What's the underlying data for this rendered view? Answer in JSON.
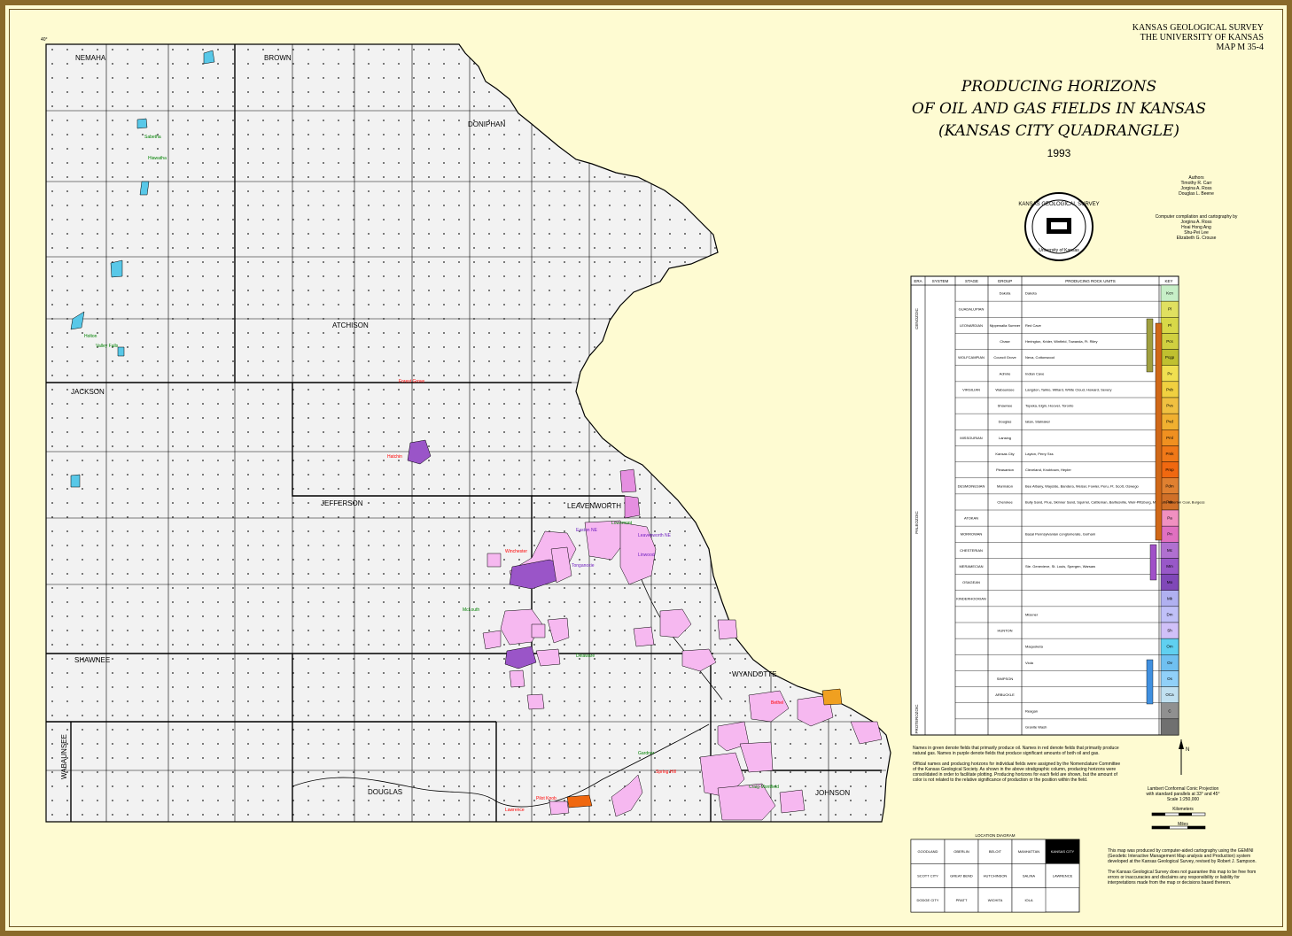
{
  "header": {
    "survey": "KANSAS GEOLOGICAL SURVEY",
    "university": "THE UNIVERSITY OF KANSAS",
    "map_no": "MAP M 35-4"
  },
  "title": {
    "line1": "PRODUCING HORIZONS",
    "line2": "OF OIL AND GAS FIELDS IN KANSAS",
    "line3": "(KANSAS CITY QUADRANGLE)",
    "year": "1993"
  },
  "credits": {
    "authors_label": "Authors",
    "authors": [
      "Timothy R. Carr",
      "Jorgina A. Ross",
      "Douglas L. Beene"
    ],
    "computer_label": "Computer compilation and cartography by",
    "computer": [
      "Jorgina A. Ross",
      "Hoai Hong Ang",
      "Shu-Pei Lee",
      "Elizabeth G. Crouse"
    ]
  },
  "seal": {
    "outer": "KANSAS GEOLOGICAL SURVEY",
    "inner": "University of Kansas"
  },
  "counties": [
    {
      "name": "NEMAHA"
    },
    {
      "name": "BROWN"
    },
    {
      "name": "DONIPHAN"
    },
    {
      "name": "ATCHISON"
    },
    {
      "name": "JACKSON"
    },
    {
      "name": "JEFFERSON"
    },
    {
      "name": "LEAVENWORTH"
    },
    {
      "name": "SHAWNEE"
    },
    {
      "name": "WYANDOTTE"
    },
    {
      "name": "DOUGLAS"
    },
    {
      "name": "JOHNSON"
    },
    {
      "name": "WABAUNSEE"
    }
  ],
  "colors": {
    "paper": "#fefbd2",
    "land": "#f2f2f2",
    "oil": "#f6b8f0",
    "gas": "#9a55c8",
    "oil_gas_oil": "#e58fe0",
    "cyan": "#58c8e8",
    "orange": "#f0a020",
    "frame": "#8a6a2a"
  },
  "strat_table": {
    "headers": [
      "ERA",
      "SYSTEM",
      "STAGE",
      "GROUP",
      "PRODUCING ROCK UNITS",
      "KEY"
    ],
    "rows": [
      {
        "group": "Dakota",
        "units": "Dakota",
        "key": "Kcn",
        "color": "#c7efc7"
      },
      {
        "stage": "GUADALUPIAN",
        "key": "Pl",
        "color": "#e0e060"
      },
      {
        "stage": "LEONARDIAN",
        "group": "Nippewalla Sumner",
        "units": "Red Cave",
        "key": "Pl",
        "color": "#d8d848"
      },
      {
        "group": "Chase",
        "units": "Herington, Krider, Winfield, Towanda, Ft. Riley",
        "key": "Pcs",
        "color": "#d0d040"
      },
      {
        "stage": "WOLFCAMPIAN",
        "group": "Council Grove",
        "units": "Neva, Cottonwood",
        "key": "Pcgp",
        "color": "#c0c030"
      },
      {
        "group": "Admire",
        "units": "Indian Cave",
        "key": "Pv",
        "color": "#f0e050"
      },
      {
        "stage": "VIRGILIAN",
        "group": "Wabaunsee",
        "units": "Langdon, Tarkio, Willard, White Cloud, Howard, Severy",
        "key": "Pvb",
        "color": "#f0d040"
      },
      {
        "group": "Shawnee",
        "units": "Topeka, Elgin, Hoover, Toronto",
        "key": "Pvs",
        "color": "#f0c040"
      },
      {
        "group": "Douglas",
        "units": "Iatan, Stalnaker",
        "key": "Pvd",
        "color": "#f0b030"
      },
      {
        "stage": "MISSOURIAN",
        "group": "Lansing",
        "key": "Pml",
        "color": "#f09020"
      },
      {
        "group": "Kansas City",
        "units": "Layton, Perry Sss",
        "key": "Pmk",
        "color": "#f07818"
      },
      {
        "group": "Pleasanton",
        "units": "Cleveland, Knobtown, Hepler",
        "key": "Pmp",
        "color": "#f06810"
      },
      {
        "stage": "DESMOINESIAN",
        "group": "Marmaton",
        "units": "Bee Albany, Wayside, Bandera, Weiser, Fowler, Peru, Ft. Scott, Oswego",
        "key": "Pdm",
        "color": "#e08030"
      },
      {
        "group": "Cherokee",
        "units": "Bully Sand, Prue, Skinner Sand, Squirrel, Cattleman, Bartlesville, Weir-Pittsburg, McLouth, Riverton Coal, Burgess",
        "key": "Pdc",
        "color": "#d07028"
      },
      {
        "stage": "ATOKAN",
        "key": "Pa",
        "color": "#f090c0"
      },
      {
        "stage": "MORROWAN",
        "units": "Basal Pennsylvanian conglomerate, Gorham",
        "key": "Pn",
        "color": "#e070c0"
      },
      {
        "stage": "CHESTERIAN",
        "key": "Mc",
        "color": "#b070d0"
      },
      {
        "stage": "MERAMECIAN",
        "units": "Ste. Genevieve, St. Louis, Spergen, Warsaw",
        "key": "Mm",
        "color": "#9858c8"
      },
      {
        "stage": "OSAGEAN",
        "key": "Mo",
        "color": "#8048b8"
      },
      {
        "stage": "KINDERHOOKIAN",
        "key": "Mk",
        "color": "#b0b0f0"
      },
      {
        "units": "Misener",
        "key": "Dm",
        "color": "#c0c0f8"
      },
      {
        "group": "HUNTON",
        "key": "Sh",
        "color": "#d0c0f8"
      },
      {
        "group": "",
        "units": "Maquoketa",
        "key": "Om",
        "color": "#60d0f0"
      },
      {
        "units": "Viola",
        "key": "Ov",
        "color": "#70c0f0"
      },
      {
        "group": "SIMPSON",
        "key": "Os",
        "color": "#90d0f8"
      },
      {
        "group": "ARBUCKLE",
        "key": "OCa",
        "color": "#c0e0f0"
      },
      {
        "units": "Reagan",
        "key": "C",
        "color": "#909090"
      },
      {
        "units": "Granite Wash",
        "key": "",
        "color": "#707070"
      }
    ],
    "era_labels": [
      "CENOZOIC",
      "PALEOZOIC",
      "PROTEROZOIC"
    ]
  },
  "notes": [
    "Names in green denote fields that primarily produce oil. Names in red denote fields that primarily produce natural gas. Names in purple denote fields that produce significant amounts of both oil and gas.",
    "Official names and producing horizons for individual fields were assigned by the Nomenclature Committee of the Kansas Geological Society. As shown in the above stratigraphic column, producing horizons were consolidated in order to facilitate plotting. Producing horizons for each field are shown, but the amount of color is not related to the relative significance of production or the position within the field."
  ],
  "projection": {
    "line1": "Lambert Conformal Conic Projection",
    "line2": "with standard parallels at 33° and 45°",
    "scale": "Scale 1:250,000",
    "km": "Kilometers",
    "mi": "Miles"
  },
  "location_diagram": {
    "title": "LOCATION DIAGRAM",
    "cells": [
      "GOODLAND",
      "OBERLIN",
      "BELOIT",
      "MANHATTAN",
      "KANSAS CITY",
      "SCOTT CITY",
      "GREAT BEND",
      "HUTCHINSON",
      "SALINA",
      "LAWRENCE",
      "DODGE CITY",
      "PRATT",
      "WICHITA",
      "IOLA"
    ]
  },
  "disclaimer": [
    "This map was produced by computer-aided cartography using the GEMINI (Geodetic Interactive Management Map analysis and Production) system developed at the Kansas Geological Survey, revised by Robert J. Sampson.",
    "The Kansas Geological Survey does not guarantee this map to be free from errors or inaccuracies and disclaims any responsibility or liability for interpretations made from the map or decisions based thereon."
  ],
  "fields": [
    {
      "name": "Forest Grove",
      "color": "#ff0000"
    },
    {
      "name": "Hatchin",
      "color": "#ff0000"
    },
    {
      "name": "Winchester",
      "color": "#ff0000"
    },
    {
      "name": "Leavenworth NE",
      "color": "#7020c0"
    },
    {
      "name": "Lowemont",
      "color": "#008000"
    },
    {
      "name": "Easton NE",
      "color": "#7020c0"
    },
    {
      "name": "Tonganoxie",
      "color": "#7020c0"
    },
    {
      "name": "McLouth",
      "color": "#008000"
    },
    {
      "name": "Linwood",
      "color": "#7020c0"
    },
    {
      "name": "Bethel",
      "color": "#ff0000"
    },
    {
      "name": "Gardner",
      "color": "#008000"
    },
    {
      "name": "Spring Hill",
      "color": "#ff0000"
    },
    {
      "name": "Craig-Montfield",
      "color": "#008000"
    },
    {
      "name": "Lawrence",
      "color": "#ff0000"
    },
    {
      "name": "Sabetha",
      "color": "#008000"
    },
    {
      "name": "Hiawatha",
      "color": "#008000"
    },
    {
      "name": "Holton",
      "color": "#008000"
    },
    {
      "name": "Valley Falls",
      "color": "#008000"
    },
    {
      "name": "Pilot Knob",
      "color": "#ff0000"
    },
    {
      "name": "Delaware",
      "color": "#008000"
    }
  ]
}
